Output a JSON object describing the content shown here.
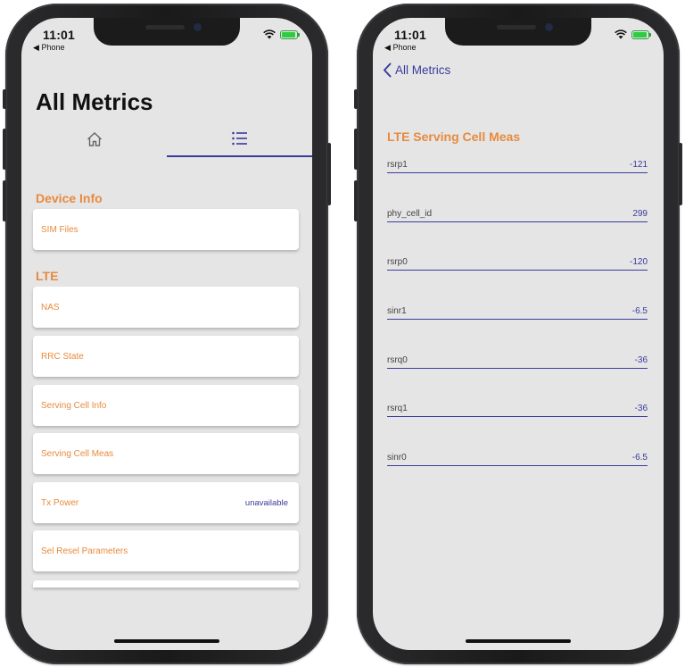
{
  "status": {
    "time": "11:01",
    "back_app": "Phone"
  },
  "left": {
    "title": "All Metrics",
    "tabs": [
      {
        "icon": "home-icon"
      },
      {
        "icon": "list-icon",
        "selected": true
      }
    ],
    "sections": [
      {
        "header": "Device Info",
        "items": [
          {
            "label": "SIM Files"
          }
        ]
      },
      {
        "header": "LTE",
        "items": [
          {
            "label": "NAS"
          },
          {
            "label": "RRC State"
          },
          {
            "label": "Serving Cell Info"
          },
          {
            "label": "Serving Cell Meas"
          },
          {
            "label": "Tx Power",
            "value": "unavailable"
          },
          {
            "label": "Sel Resel Parameters"
          }
        ]
      }
    ]
  },
  "right": {
    "back_label": "All Metrics",
    "section": "LTE Serving Cell Meas",
    "metrics": [
      {
        "name": "rsrp1",
        "value": "-121"
      },
      {
        "name": "phy_cell_id",
        "value": "299"
      },
      {
        "name": "rsrp0",
        "value": "-120"
      },
      {
        "name": "sinr1",
        "value": "-6.5"
      },
      {
        "name": "rsrq0",
        "value": "-36"
      },
      {
        "name": "rsrq1",
        "value": "-36"
      },
      {
        "name": "sinr0",
        "value": "-6.5"
      }
    ]
  },
  "colors": {
    "accent_orange": "#e88a3c",
    "accent_blue": "#3b3b9c",
    "screen_bg": "#e5e5e6"
  }
}
